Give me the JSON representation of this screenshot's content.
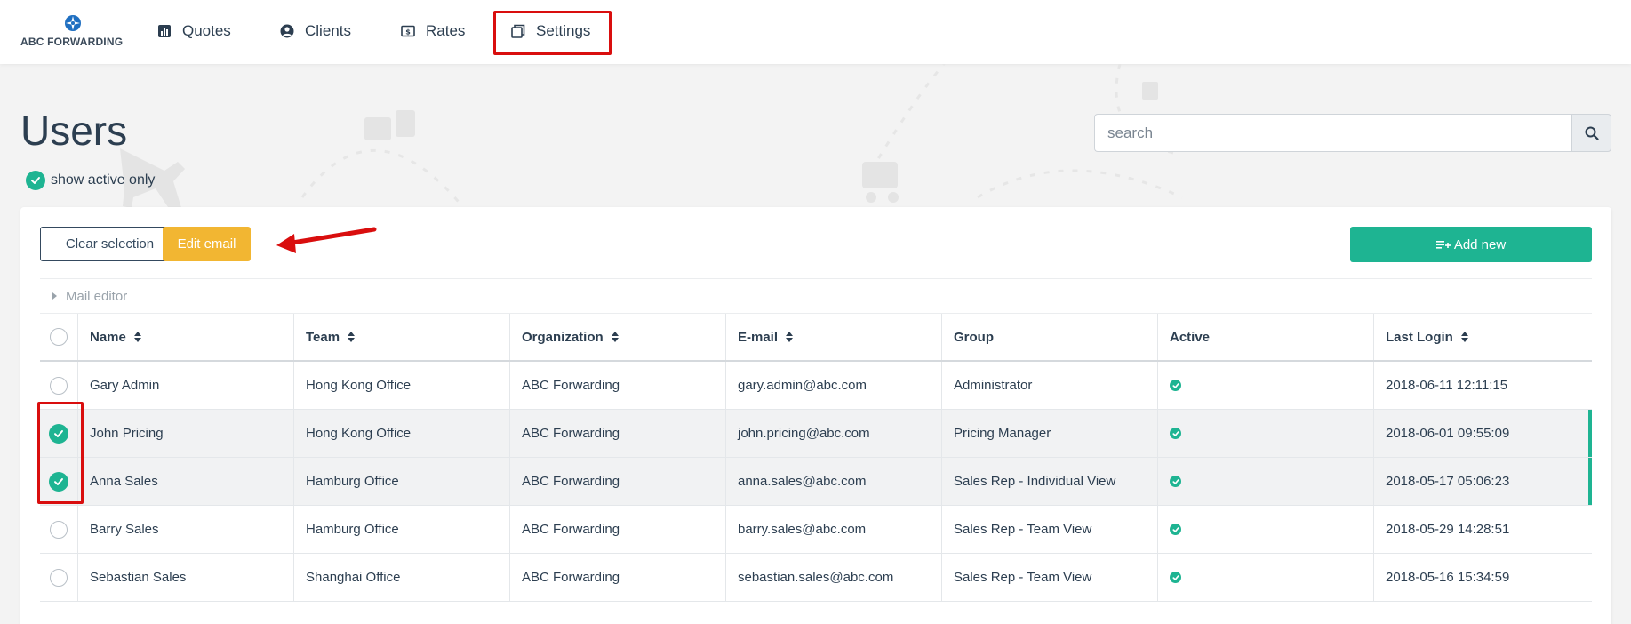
{
  "brand": {
    "name": "ABC FORWARDING"
  },
  "nav": {
    "items": [
      {
        "label": "Quotes",
        "icon": "bar-chart-icon"
      },
      {
        "label": "Clients",
        "icon": "user-circle-icon"
      },
      {
        "label": "Rates",
        "icon": "dollar-bill-icon"
      },
      {
        "label": "Settings",
        "icon": "windows-icon"
      }
    ]
  },
  "page": {
    "title": "Users",
    "show_active_label": "show active only"
  },
  "search": {
    "placeholder": "search",
    "value": ""
  },
  "toolbar": {
    "clear_label": "Clear selection",
    "edit_email_label": "Edit email",
    "add_new_label": "Add new",
    "mail_editor_label": "Mail editor"
  },
  "table": {
    "columns": [
      {
        "label": "Name",
        "sortable": true
      },
      {
        "label": "Team",
        "sortable": true
      },
      {
        "label": "Organization",
        "sortable": true
      },
      {
        "label": "E-mail",
        "sortable": true
      },
      {
        "label": "Group",
        "sortable": false
      },
      {
        "label": "Active",
        "sortable": false
      },
      {
        "label": "Last Login",
        "sortable": true
      }
    ],
    "rows": [
      {
        "selected": false,
        "name": "Gary Admin",
        "team": "Hong Kong Office",
        "organization": "ABC Forwarding",
        "email": "gary.admin@abc.com",
        "group": "Administrator",
        "active": true,
        "last_login": "2018-06-11 12:11:15"
      },
      {
        "selected": true,
        "name": "John Pricing",
        "team": "Hong Kong Office",
        "organization": "ABC Forwarding",
        "email": "john.pricing@abc.com",
        "group": "Pricing Manager",
        "active": true,
        "last_login": "2018-06-01 09:55:09"
      },
      {
        "selected": true,
        "name": "Anna Sales",
        "team": "Hamburg Office",
        "organization": "ABC Forwarding",
        "email": "anna.sales@abc.com",
        "group": "Sales Rep - Individual View",
        "active": true,
        "last_login": "2018-05-17 05:06:23"
      },
      {
        "selected": false,
        "name": "Barry Sales",
        "team": "Hamburg Office",
        "organization": "ABC Forwarding",
        "email": "barry.sales@abc.com",
        "group": "Sales Rep - Team View",
        "active": true,
        "last_login": "2018-05-29 14:28:51"
      },
      {
        "selected": false,
        "name": "Sebastian Sales",
        "team": "Shanghai Office",
        "organization": "ABC Forwarding",
        "email": "sebastian.sales@abc.com",
        "group": "Sales Rep - Team View",
        "active": true,
        "last_login": "2018-05-16 15:34:59"
      }
    ]
  },
  "colors": {
    "accent": "#1eb492",
    "warning": "#f2b632",
    "annotation": "#d90e0e",
    "text": "#2c3e50"
  }
}
